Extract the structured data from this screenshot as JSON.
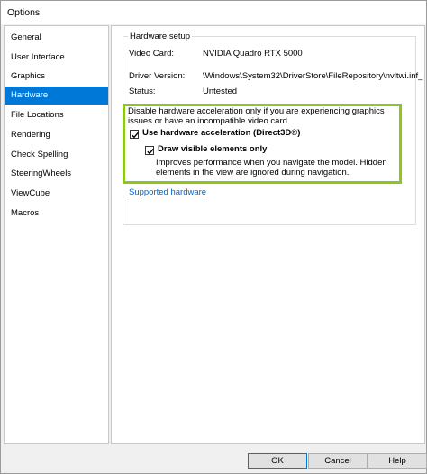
{
  "window": {
    "title": "Options"
  },
  "sidebar": {
    "items": [
      {
        "label": "General"
      },
      {
        "label": "User Interface"
      },
      {
        "label": "Graphics"
      },
      {
        "label": "Hardware",
        "selected": true
      },
      {
        "label": "File Locations"
      },
      {
        "label": "Rendering"
      },
      {
        "label": "Check Spelling"
      },
      {
        "label": "SteeringWheels"
      },
      {
        "label": "ViewCube"
      },
      {
        "label": "Macros"
      }
    ]
  },
  "hardware": {
    "group_title": "Hardware setup",
    "video_card_label": "Video Card:",
    "video_card_value": "NVIDIA Quadro RTX 5000",
    "driver_label": "Driver Version:",
    "driver_value": "\\Windows\\System32\\DriverStore\\FileRepository\\nvltwi.inf_",
    "status_label": "Status:",
    "status_value": "Untested",
    "warning_text": "Disable hardware acceleration only if you are experiencing graphics issues or have an incompatible video card.",
    "use_hw_accel_label": "Use hardware acceleration (Direct3D®)",
    "use_hw_accel_checked": true,
    "draw_visible_label": "Draw visible elements only",
    "draw_visible_checked": true,
    "draw_visible_desc": "Improves performance when you navigate the model. Hidden elements in the view are ignored during navigation.",
    "supported_link": "Supported hardware",
    "highlight_color": "#8cc61f"
  },
  "footer": {
    "ok_label": "OK",
    "cancel_label": "Cancel",
    "help_label": "Help"
  },
  "colors": {
    "selection": "#0078d7",
    "link": "#0066cc"
  }
}
